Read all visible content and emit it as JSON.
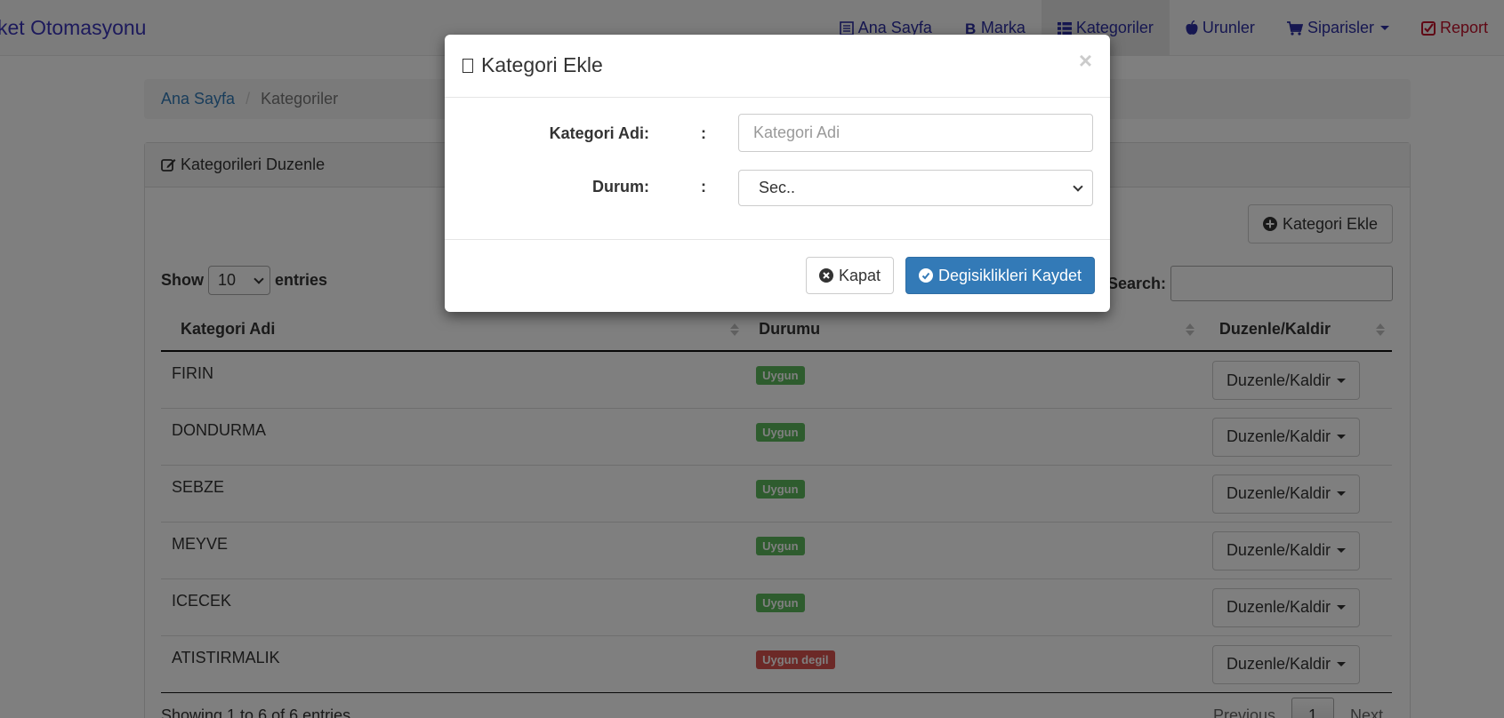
{
  "navbar": {
    "brand": "ket Otomasyonu",
    "items": [
      {
        "label": "Ana Sayfa",
        "icon": "list-alt-icon"
      },
      {
        "label": "Marka",
        "icon": "bitcoin-icon"
      },
      {
        "label": "Kategoriler",
        "icon": "th-list-icon"
      },
      {
        "label": "Urunler",
        "icon": "apple-icon"
      },
      {
        "label": "Siparisler",
        "icon": "shopping-cart-icon"
      },
      {
        "label": "Report",
        "icon": "check-square-icon"
      }
    ],
    "active_item": "Kategoriler"
  },
  "breadcrumb": {
    "home": "Ana Sayfa",
    "current": "Kategoriler"
  },
  "panel": {
    "title": "Kategorileri Duzenle",
    "add_button": "Kategori Ekle",
    "show_label": "Show",
    "entries_label": "entries",
    "page_length": "10",
    "search_label": "Search:",
    "search_value": "",
    "columns": [
      "Kategori Adi",
      "Durumu",
      "Duzenle/Kaldir"
    ],
    "rows": [
      {
        "name": "FIRIN",
        "status": "Uygun",
        "action": "Duzenle/Kaldir"
      },
      {
        "name": "DONDURMA",
        "status": "Uygun",
        "action": "Duzenle/Kaldir"
      },
      {
        "name": "SEBZE",
        "status": "Uygun",
        "action": "Duzenle/Kaldir"
      },
      {
        "name": "MEYVE",
        "status": "Uygun",
        "action": "Duzenle/Kaldir"
      },
      {
        "name": "ICECEK",
        "status": "Uygun",
        "action": "Duzenle/Kaldir"
      },
      {
        "name": "ATISTIRMALIK",
        "status": "Uygun degil",
        "action": "Duzenle/Kaldir"
      }
    ],
    "info": "Showing 1 to 6 of 6 entries",
    "pagination": {
      "previous": "Previous",
      "page": "1",
      "next": "Next"
    }
  },
  "modal": {
    "title": "Kategori Ekle",
    "close_glyph": "×",
    "fields": {
      "name_label": "Kategori Adi:",
      "name_placeholder": "Kategori Adi",
      "name_value": "",
      "status_label": "Durum:",
      "status_selected": "Sec..",
      "colon": ":"
    },
    "close_button": "Kapat",
    "save_button": "Degisiklikleri Kaydet"
  },
  "colors": {
    "primary": "#337ab7",
    "success": "#5cb85c",
    "danger": "#d9534f",
    "nav_link": "#2d2fa3",
    "report_link": "#c0102a"
  }
}
